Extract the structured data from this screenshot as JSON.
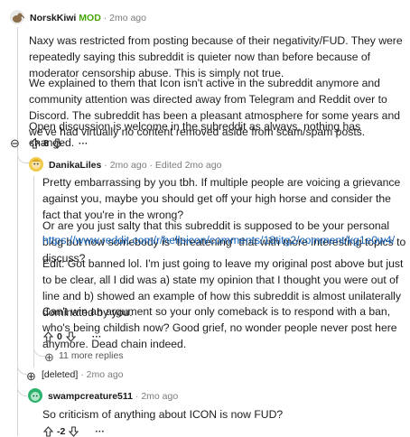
{
  "comments": [
    {
      "author": "NorskKiwi",
      "flair": "MOD",
      "time": "· 2mo ago",
      "paragraphs": [
        "Naxy was restricted from posting because of their negativity/FUD. They were repeatedly saying this subreddit is quieter now than before because of moderator censorship abuse. This is simply not true.",
        "We explained to them that Icon isn't active in the subreddit anymore and community attention was directed away from Telegram and Reddit over to Discord. The subreddit has been a pleasant atmosphere for some years and we've had virtually no content removed aside from scam/spam posts.",
        "Open discussion is welcome in the subreddit as always, nothing has changed."
      ],
      "score": "8",
      "more": "···"
    },
    {
      "author": "DanikaLiles",
      "time": "· 2mo ago · Edited 2mo ago",
      "paragraphs": [
        "Pretty embarrassing by you tbh. If multiple people are voicing a grievance against you, maybe you should get off your high horse and consider the fact that you're in the wrong?",
        "Or are you just salty that this subreddit is supposed to be your personal blog but now somebody is \"threatening\" that with more interesting topics to discuss?",
        "Edit: Got banned lol. I'm just going to leave my original post above but just to be clear, all I did was a) state my opinion that I thought you were out of line and b) showed an example of how this subreddit is almost unilaterally dominated by you.",
        "Can't win an argument so your only comeback is to respond with a ban, who's being childish now? Good grief, no wonder people never post here anymore. Dead chain indeed."
      ],
      "link": "https://www.reddit.com/r/helloicon/comments/18titg2/comment/kg1e0w4/",
      "score": "0",
      "more": "···",
      "more_replies": "11 more replies"
    },
    {
      "author": "[deleted]",
      "time": "· 2mo ago"
    },
    {
      "author": "swampcreature511",
      "time": "· 2mo ago",
      "paragraphs": [
        "So criticism of anything about ICON is now FUD?"
      ],
      "score": "-2",
      "more": "···"
    }
  ],
  "icons": {
    "collapse": "⊖",
    "expand": "⊕",
    "upvote": "upvote-icon",
    "downvote": "downvote-icon"
  },
  "colors": {
    "mod": "#46a508",
    "link": "#1565c0",
    "thread": "#d6d6d6"
  }
}
